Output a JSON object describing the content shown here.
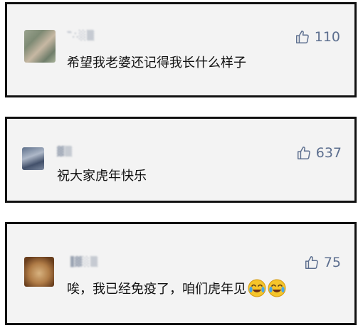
{
  "comments": [
    {
      "username": "‷∴░▒",
      "likes": "110",
      "text": "希望我老婆还记得我长什么样子",
      "emojis": []
    },
    {
      "username": "▓▒",
      "likes": "637",
      "text": "祝大家虎年快乐",
      "emojis": []
    },
    {
      "username": "▐▓░▒",
      "likes": "75",
      "text": "唉，我已经免疫了，咱们虎年见",
      "emojis": [
        "crying-laughing-icon",
        "crying-laughing-icon"
      ]
    }
  ]
}
